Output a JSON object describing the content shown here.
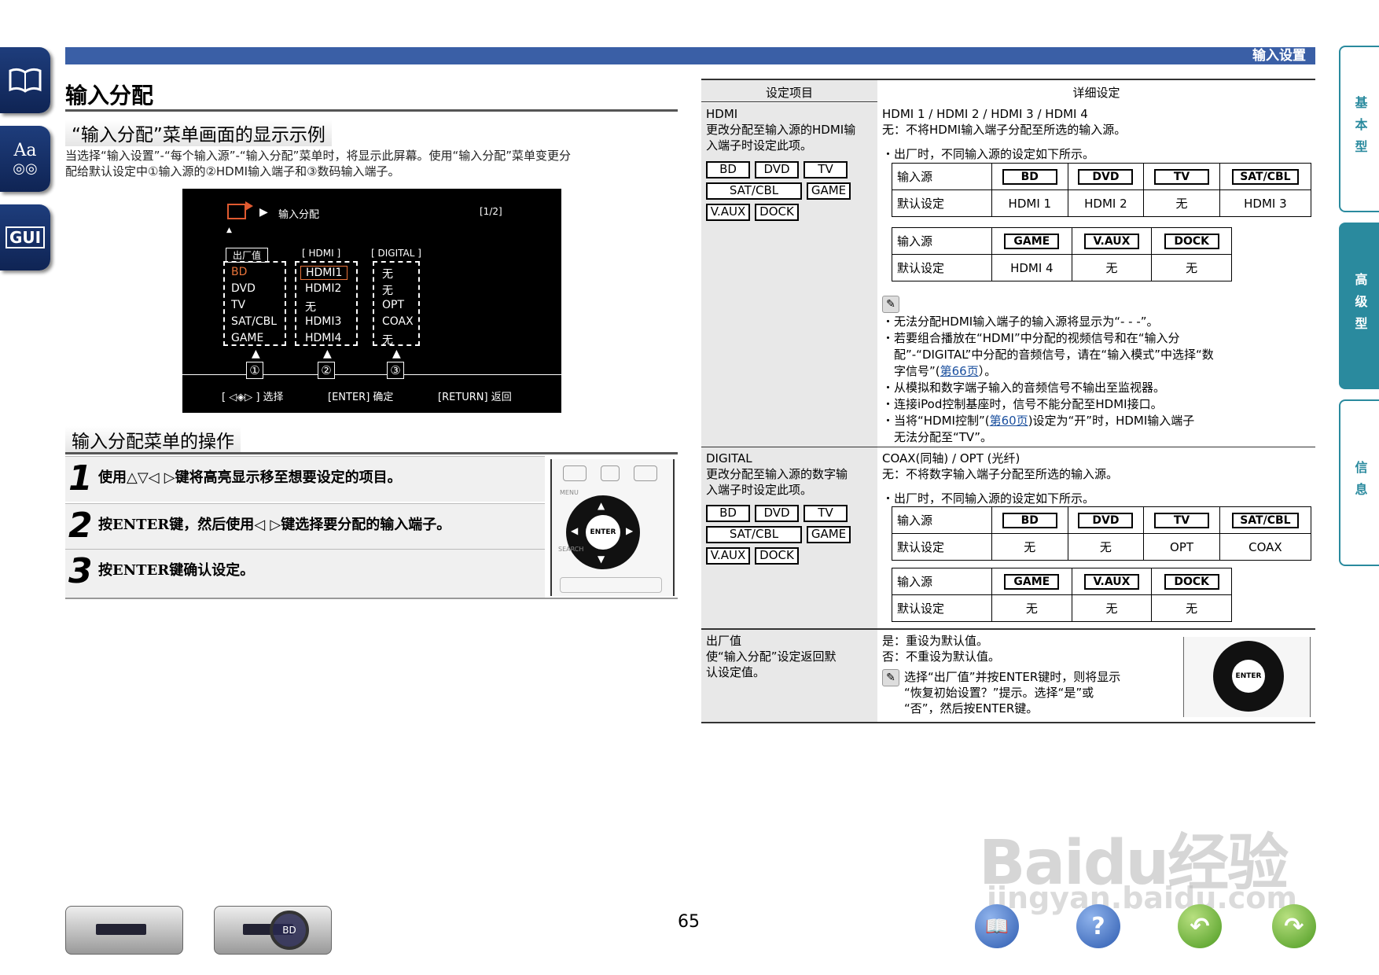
{
  "header": {
    "section": "输入设置"
  },
  "left_tabs": [
    {
      "icon": "book-icon"
    },
    {
      "icon": "font-glasses-icon",
      "label": "Aa"
    },
    {
      "icon": "gui-icon",
      "label": "GUI"
    }
  ],
  "right_tabs": [
    {
      "label": "基本型"
    },
    {
      "label": "高级型"
    },
    {
      "label": "信息"
    }
  ],
  "title": "输入分配",
  "sec1": {
    "title": "“输入分配”菜单画面的显示示例",
    "text1": "当选择“输入设置”-“每个输入源”-“输入分配”菜单时，将显示此屏幕。使用“输入分配”菜单变更分",
    "text2": "配给默认设定中①输入源的②HDMI输入端子和③数码输入端子。"
  },
  "screen": {
    "title": "输入分配",
    "page": "[1/2]",
    "col1_head": "出厂值",
    "col2_head": "[ HDMI ]",
    "col3_head": "[ DIGITAL ]",
    "col1": [
      "BD",
      "DVD",
      "TV",
      "SAT/CBL",
      "GAME"
    ],
    "col2": [
      "HDMI1",
      "HDMI2",
      "无",
      "HDMI3",
      "HDMI4"
    ],
    "col3": [
      "无",
      "无",
      "OPT",
      "COAX",
      "无"
    ],
    "marks": [
      "①",
      "②",
      "③"
    ],
    "footer_select": "选择",
    "footer_enter": "[ENTER] 确定",
    "footer_return": "[RETURN] 返回"
  },
  "sec2": {
    "title": "输入分配菜单的操作"
  },
  "steps": [
    {
      "num": "1",
      "text": "使用△▽◁ ▷键将高亮显示移至想要设定的项目。"
    },
    {
      "num": "2",
      "text": "按ENTER键，然后使用◁ ▷键选择要分配的输入端子。"
    },
    {
      "num": "3",
      "text": "按ENTER键确认设定。"
    }
  ],
  "remote": {
    "enter": "ENTER",
    "menu": "MENU",
    "search": "SEARCH"
  },
  "table": {
    "head_left": "设定项目",
    "head_right": "详细设定",
    "hdmi": {
      "name": "HDMI",
      "desc1": "更改分配至输入源的HDMI输",
      "desc2": "入端子时设定此项。",
      "opts": "HDMI 1 / HDMI 2 / HDMI 3 / HDMI 4",
      "none": "无：不将HDMI输入端子分配至所选的输入源。",
      "factory": "・出厂时，不同输入源的设定如下所示。",
      "src_label": "输入源",
      "def_label": "默认设定",
      "row1_src": [
        "BD",
        "DVD",
        "TV",
        "SAT/CBL"
      ],
      "row1_def": [
        "HDMI 1",
        "HDMI 2",
        "无",
        "HDMI 3"
      ],
      "row2_src": [
        "GAME",
        "V.AUX",
        "DOCK"
      ],
      "row2_def": [
        "HDMI 4",
        "无",
        "无"
      ],
      "notes": [
        "・无法分配HDMI输入端子的输入源将显示为“- - -”。",
        "・若要组合播放在“HDMI”中分配的视频信号和在“输入分",
        "　配”-“DIGITAL”中分配的音频信号，请在“输入模式”中选择“数",
        "　字信号”(",
        "第66页",
        "）。",
        "・从模拟和数字端子输入的音频信号不输出至监视器。",
        "・连接iPod控制基座时，信号不能分配至HDMI接口。",
        "・当将“HDMI控制”(",
        "第60页",
        ")设定为“开”时，HDMI输入端子",
        "　无法分配至“TV”。"
      ]
    },
    "digital": {
      "name": "DIGITAL",
      "desc1": "更改分配至输入源的数字输",
      "desc2": "入端子时设定此项。",
      "opts": "COAX(同轴) / OPT (光纤)",
      "none": "无：不将数字输入端子分配至所选的输入源。",
      "factory": "・出厂时，不同输入源的设定如下所示。",
      "row1_src": [
        "BD",
        "DVD",
        "TV",
        "SAT/CBL"
      ],
      "row1_def": [
        "无",
        "无",
        "OPT",
        "COAX"
      ],
      "row2_src": [
        "GAME",
        "V.AUX",
        "DOCK"
      ],
      "row2_def": [
        "无",
        "无",
        "无"
      ]
    },
    "chips": [
      "BD",
      "DVD",
      "TV",
      "SAT/CBL",
      "GAME",
      "V.AUX",
      "DOCK"
    ],
    "reset": {
      "name": "出厂值",
      "desc1": "使“输入分配”设定返回默",
      "desc2": "认设定值。",
      "yes": "是：重设为默认值。",
      "no": "否：不重设为默认值。",
      "note1": "选择“出厂值”并按ENTER键时，则将显示",
      "note2": "“恢复初始设置？”提示。选择“是”或",
      "note3": "“否”，然后按ENTER键。"
    }
  },
  "page_number": "65",
  "watermark": {
    "main": "Baidu经验",
    "sub": "jingyan.baidu.com"
  },
  "device_display": "BD"
}
